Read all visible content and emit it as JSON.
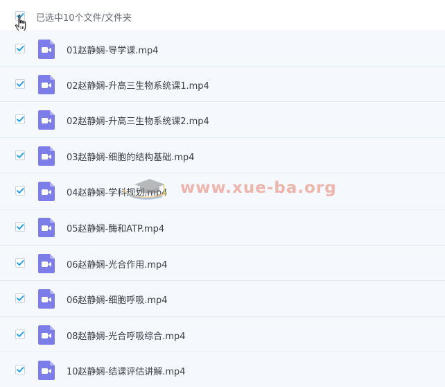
{
  "header": {
    "select_all_checked": true,
    "selection_label": "已选中10个文件/文件夹"
  },
  "files": [
    {
      "name": "01赵静娴-导学课.mp4",
      "checked": true
    },
    {
      "name": "02赵静娴-升高三生物系统课1.mp4",
      "checked": true
    },
    {
      "name": "02赵静娴-升高三生物系统课2.mp4",
      "checked": true
    },
    {
      "name": "03赵静娴-细胞的结构基础.mp4",
      "checked": true
    },
    {
      "name": "04赵静娴-学科规划.mp4",
      "checked": true
    },
    {
      "name": "05赵静娴-酶和ATP.mp4",
      "checked": true
    },
    {
      "name": "06赵静娴-光合作用.mp4",
      "checked": true
    },
    {
      "name": "06赵静娴-细胞呼吸.mp4",
      "checked": true
    },
    {
      "name": "08赵静娴-光合呼吸综合.mp4",
      "checked": true
    },
    {
      "name": "10赵静娴-结课评估讲解.mp4",
      "checked": true
    }
  ],
  "file_icon": "video-file-icon",
  "watermark": {
    "text": "www.xue-ba.org"
  },
  "colors": {
    "check": "#1e9ff2",
    "file_icon": "#7d7dea",
    "row_background": "#f5f9fd",
    "row_border": "#e1ecf7",
    "watermark": "#ea8a7c"
  }
}
